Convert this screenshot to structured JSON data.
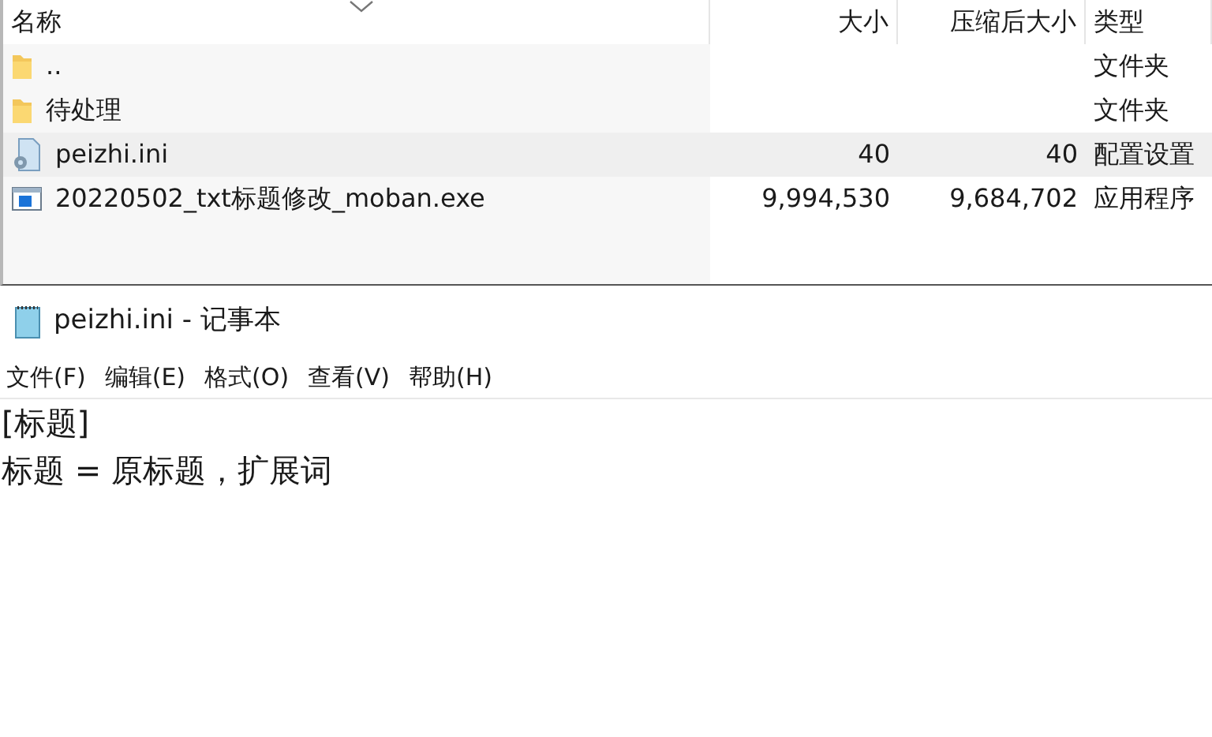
{
  "explorer": {
    "columns": [
      "名称",
      "大小",
      "压缩后大小",
      "类型"
    ],
    "rows": [
      {
        "kind": "folder",
        "name": "..",
        "size": "",
        "packed": "",
        "type": "文件夹",
        "selected": false
      },
      {
        "kind": "folder",
        "name": "待处理",
        "size": "",
        "packed": "",
        "type": "文件夹",
        "selected": false
      },
      {
        "kind": "config",
        "name": "peizhi.ini",
        "size": "40",
        "packed": "40",
        "type": "配置设置",
        "selected": true
      },
      {
        "kind": "exe",
        "name": "20220502_txt标题修改_moban.exe",
        "size": "9,994,530",
        "packed": "9,684,702",
        "type": "应用程序",
        "selected": false
      }
    ]
  },
  "notepad": {
    "title": "peizhi.ini - 记事本",
    "menu": [
      "文件(F)",
      "编辑(E)",
      "格式(O)",
      "查看(V)",
      "帮助(H)"
    ],
    "lines": [
      "[标题]",
      "标题 = 原标题，扩展词"
    ]
  }
}
